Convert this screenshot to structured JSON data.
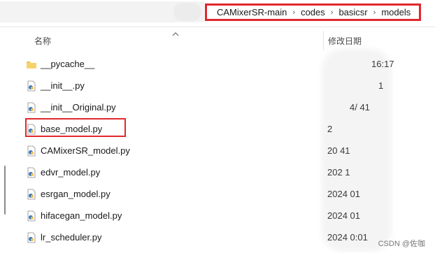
{
  "address": {
    "crumbs": [
      "CAMixerSR-main",
      "codes",
      "basicsr",
      "models"
    ],
    "separator": "›"
  },
  "columns": {
    "name": "名称",
    "modified": "修改日期"
  },
  "files": [
    {
      "name": "__pycache__",
      "type": "folder",
      "date": "16:17"
    },
    {
      "name": "__init__.py",
      "type": "python",
      "date": "1"
    },
    {
      "name": "__init__Original.py",
      "type": "python",
      "date": "4/ 41"
    },
    {
      "name": "base_model.py",
      "type": "python",
      "date": "2"
    },
    {
      "name": "CAMixerSR_model.py",
      "type": "python",
      "date": "20 41"
    },
    {
      "name": "edvr_model.py",
      "type": "python",
      "date": "202 1"
    },
    {
      "name": "esrgan_model.py",
      "type": "python",
      "date": "2024 01"
    },
    {
      "name": "hifacegan_model.py",
      "type": "python",
      "date": "2024 01"
    },
    {
      "name": "lr_scheduler.py",
      "type": "python",
      "date": "2024 0:01"
    }
  ],
  "highlighted_file": "base_model.py",
  "watermark": "CSDN @佐咖",
  "colors": {
    "highlight": "#e0282e",
    "folder": "#f2c14e",
    "python_icon": "#3a78c2"
  }
}
